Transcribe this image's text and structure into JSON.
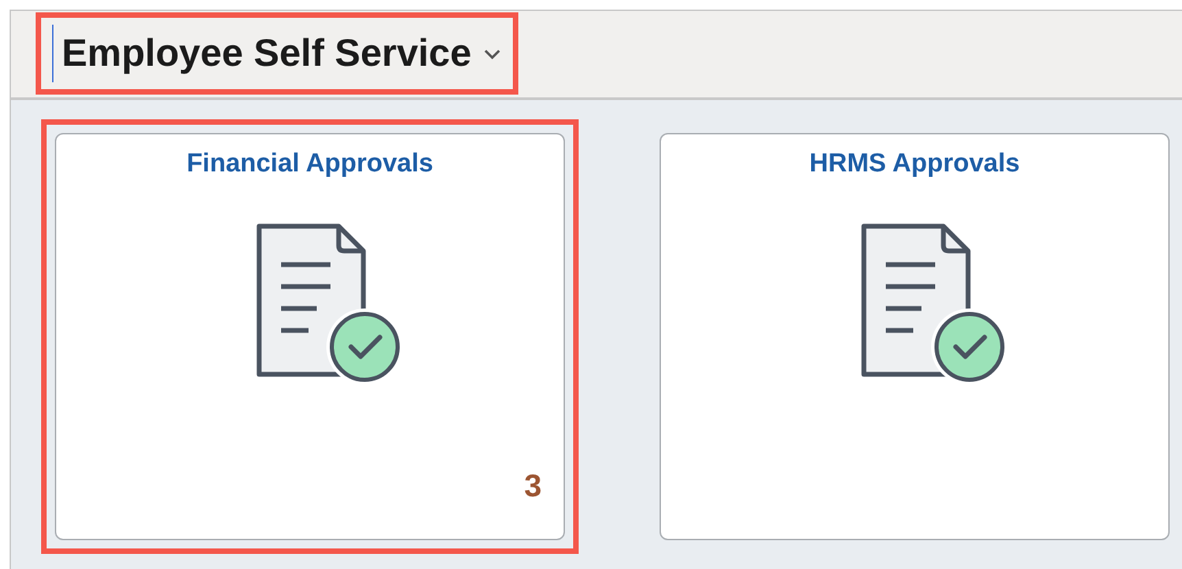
{
  "header": {
    "title": "Employee Self Service",
    "highlighted": true
  },
  "tiles": [
    {
      "title": "Financial Approvals",
      "badge": "3",
      "highlighted": true
    },
    {
      "title": "HRMS Approvals",
      "highlighted": false
    }
  ]
}
